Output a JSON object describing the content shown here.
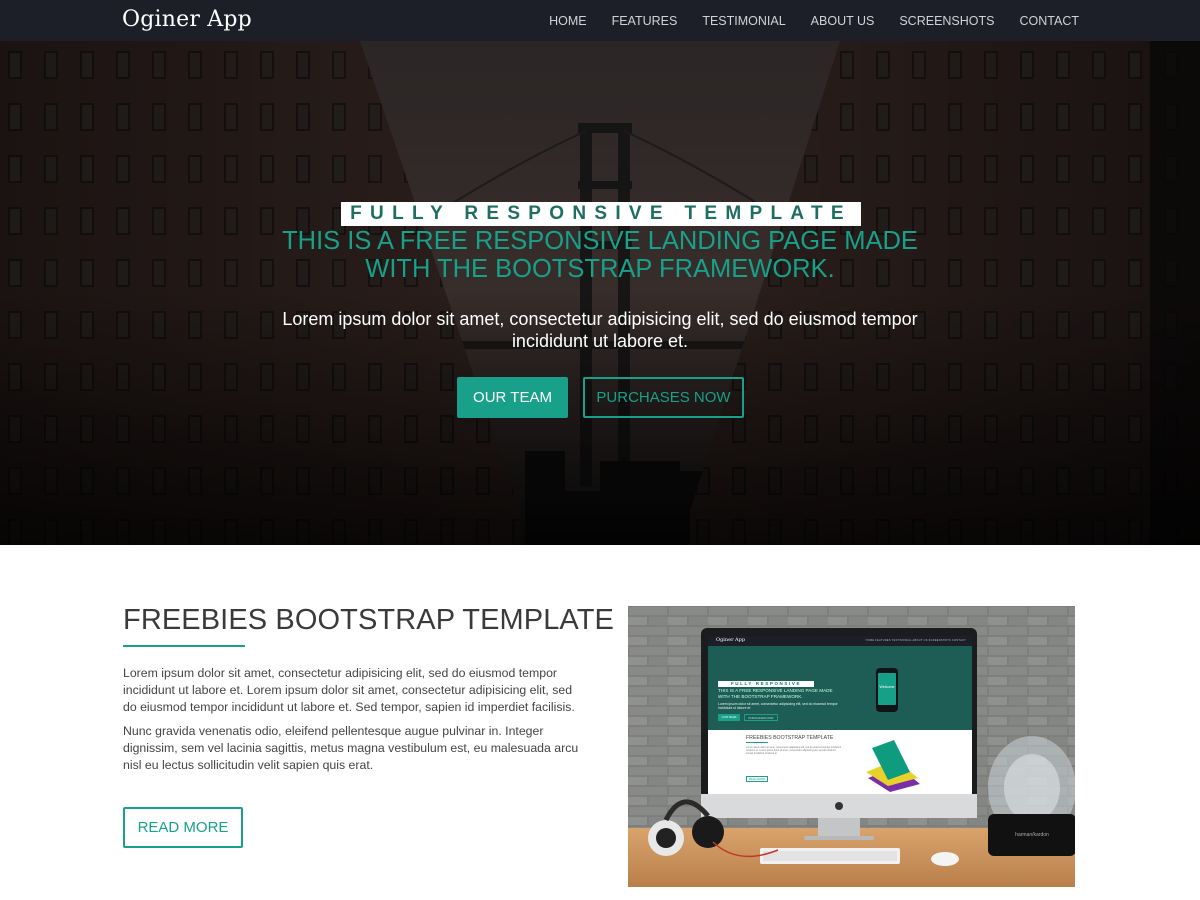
{
  "brand": "Oginer App",
  "nav": {
    "items": [
      {
        "label": "HOME"
      },
      {
        "label": "FEATURES"
      },
      {
        "label": "TESTIMONIAL"
      },
      {
        "label": "ABOUT US"
      },
      {
        "label": "SCREENSHOTS"
      },
      {
        "label": "CONTACT"
      }
    ]
  },
  "hero": {
    "badge": "FULLY RESPONSIVE TEMPLATE",
    "title": "THIS IS A FREE RESPONSIVE LANDING PAGE MADE WITH THE BOOTSTRAP FRAMEWORK.",
    "subtitle": "Lorem ipsum dolor sit amet, consectetur adipisicing elit, sed do eiusmod tempor incididunt ut labore et.",
    "primary_button": "OUR TEAM",
    "secondary_button": "PURCHASES NOW"
  },
  "section": {
    "title": "FREEBIES BOOTSTRAP TEMPLATE",
    "paragraph1": "Lorem ipsum dolor sit amet, consectetur adipisicing elit, sed do eiusmod tempor incididunt ut labore et. Lorem ipsum dolor sit amet, consectetur adipisicing elit, sed do eiusmod tempor incididunt ut labore et. Sed tempor, sapien id imperdiet facilisis.",
    "paragraph2": "Nunc gravida venenatis odio, eleifend pellentesque augue pulvinar in. Integer dignissim, sem vel lacinia sagittis, metus magna vestibulum est, eu malesuada arcu nisl eu lectus sollicitudin velit sapien quis erat.",
    "button": "READ MORE"
  },
  "photo": {
    "screen": {
      "brand": "Oginer App",
      "links": "HOME  FEATURES  TESTIMONIAL  ABOUT US  SCREENSHOTS  CONTACT",
      "badge": "FULLY RESPONSIVE TEMPLATE",
      "title": "THIS IS A FREE RESPONSIVE LANDING PAGE MADE WITH THE BOOTSTRAP FRAMEWORK.",
      "subtitle": "Lorem ipsum dolor sit amet, consectetur adipisicing elit, sed do eiusmod tempor incididunt ut labore et.",
      "btn1": "OUR TEAM",
      "btn2": "PURCHASES NOW",
      "phone_text": "Welcome",
      "section_title": "FREEBIES BOOTSTRAP TEMPLATE",
      "section_text": "Lorem ipsum dolor sit amet, consectetur adipisicing elit, sed do eiusmod tempor incididunt ut labore et. Lorem ipsum dolor sit amet, consectetur adipisicing elit, sed do eiusmod tempor incididunt ut labore et.",
      "section_button": "READ MORE"
    },
    "speaker_brand": "harman/kardon"
  },
  "colors": {
    "accent": "#18a08a",
    "navbar_bg": "#1c1f27",
    "badge_text": "#1f6e62",
    "body_text": "#444444",
    "heading_text": "#3a3a3a"
  }
}
